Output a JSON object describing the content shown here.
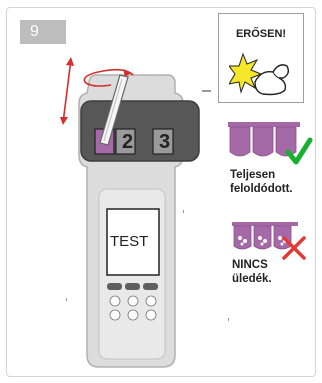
{
  "step": {
    "number": "9"
  },
  "device": {
    "slots": [
      "2",
      "3"
    ],
    "screen_text": "TEST"
  },
  "warning": {
    "title": "ERŐSEN!",
    "icon": "flexed-arm-strength-icon"
  },
  "dissolved": {
    "label_line1": "Teljesen",
    "label_line2": "feloldódott.",
    "icon": "checkmark-icon",
    "status_color": "#17b031"
  },
  "residue": {
    "label_line1": "NINCS",
    "label_line2": "üledék.",
    "icon": "cross-icon",
    "status_color": "#e53935"
  },
  "colors": {
    "reagent": "#a569a8",
    "arrow": "#d32f2f"
  }
}
